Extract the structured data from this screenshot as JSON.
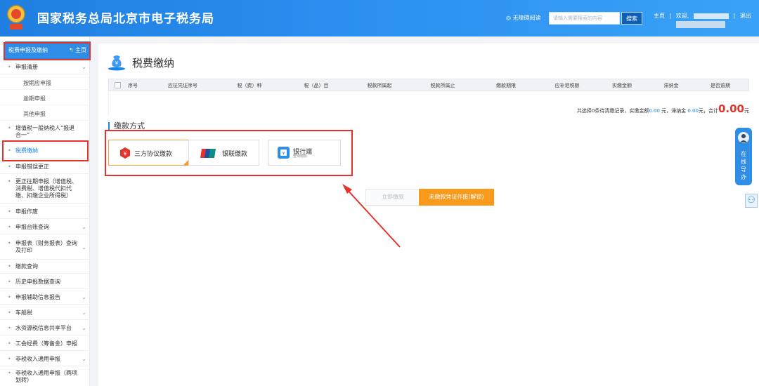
{
  "header": {
    "title": "国家税务总局北京市电子税务局",
    "accessibility": "无障碍阅读",
    "search_placeholder": "请输入需要搜索的内容",
    "search_button": "搜索",
    "home_link": "主页",
    "separator": "|",
    "welcome": "欢迎,",
    "logout": "退出",
    "emblem_icon": "tax-emblem-icon"
  },
  "sidebar": {
    "head_label": "税费申报及缴纳",
    "home_label": "主页",
    "items": [
      {
        "label": "申报清册",
        "type": "item"
      },
      {
        "label": "按期应申报",
        "type": "sub"
      },
      {
        "label": "逾期申报",
        "type": "sub"
      },
      {
        "label": "其他申报",
        "type": "sub"
      },
      {
        "label": "增值税一般纳税人“报退合一”",
        "type": "item"
      },
      {
        "label": "税费缴纳",
        "type": "item",
        "active": true
      },
      {
        "label": "申报错误更正",
        "type": "item"
      },
      {
        "label": "更正往期申报（增值税、消费税、增值税代扣代缴、扣缴企业所得税）",
        "type": "item"
      },
      {
        "label": "申报作废",
        "type": "item"
      },
      {
        "label": "申报台账查询",
        "type": "item"
      },
      {
        "label": "申报表（财务报表）查询及打印",
        "type": "item"
      },
      {
        "label": "缴款查询",
        "type": "item"
      },
      {
        "label": "历史申报数据查询",
        "type": "item"
      },
      {
        "label": "申报辅助信息报告",
        "type": "item"
      },
      {
        "label": "车船税",
        "type": "item"
      },
      {
        "label": "水资源税信息共享平台",
        "type": "item"
      },
      {
        "label": "工会经费（筹备金）申报",
        "type": "item"
      },
      {
        "label": "非税收入通用申报",
        "type": "item"
      },
      {
        "label": "非税收入通用申报（两项划转）",
        "type": "item"
      }
    ]
  },
  "main": {
    "title": "税费缴纳",
    "columns": [
      "序号",
      "应征凭证序号",
      "税（费）种",
      "税（品）目",
      "税款所属起",
      "税款所属止",
      "缴款期限",
      "应补退税额",
      "实缴金额",
      "滞纳金",
      "是否逾期"
    ],
    "summary": {
      "prefix": "共选择0条待清缴记录，实缴金额",
      "paid": "0.00",
      "mid1": " 元，滞纳金 ",
      "late": "0.00",
      "mid2": "元，合计",
      "total": "0.00",
      "suffix": "元"
    },
    "section_title": "缴款方式",
    "payment_methods": [
      {
        "label": "三方协议缴款",
        "icon": "tripartite-agreement-icon",
        "selected": true
      },
      {
        "label": "银联缴款",
        "icon": "unionpay-icon",
        "selected": false
      },
      {
        "label": "银行端",
        "sublabel": "查询缴款",
        "icon": "bank-end-icon",
        "selected": false
      }
    ],
    "buttons": {
      "pay_now": "立即缴款",
      "void_unpaid": "未缴款凭证作废(解锁)"
    }
  },
  "float": {
    "help_text": [
      "在",
      "线",
      "导",
      "办"
    ],
    "user_icon": "user-icon"
  },
  "colors": {
    "header_blue": "#2a8ff0",
    "accent_blue": "#1a86e8",
    "highlight_red": "#e5322b",
    "orange_button": "#f89a1c"
  }
}
